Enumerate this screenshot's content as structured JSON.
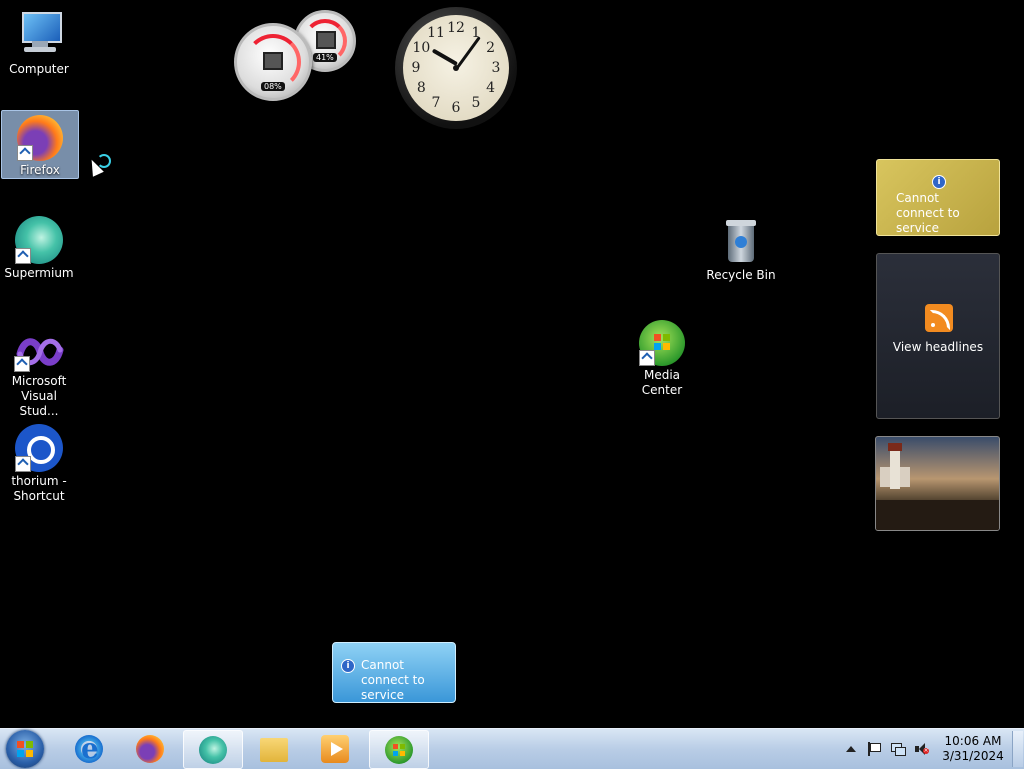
{
  "desktop": {
    "icons": [
      {
        "label": "Computer",
        "icon": "computer-icon"
      },
      {
        "label": "Firefox",
        "icon": "firefox-icon"
      },
      {
        "label": "Supermium",
        "icon": "supermium-icon"
      },
      {
        "label": "Microsoft Visual Stud...",
        "icon": "visual-studio-icon"
      },
      {
        "label": "thorium - Shortcut",
        "icon": "thorium-icon"
      },
      {
        "label": "Recycle Bin",
        "icon": "recycle-bin-icon"
      },
      {
        "label": "Media Center",
        "icon": "media-center-icon"
      }
    ]
  },
  "gadgets": {
    "cpu_meter": {
      "cpu": "08%",
      "memory": "41%"
    },
    "clock": {
      "numerals": [
        "12",
        "1",
        "2",
        "3",
        "4",
        "5",
        "6",
        "7",
        "8",
        "9",
        "10",
        "11"
      ]
    },
    "currency": {
      "message": "Cannot connect to service"
    },
    "feed": {
      "message": "View headlines"
    },
    "slideshow": {
      "image": "lighthouse-photo"
    }
  },
  "notification": {
    "message": "Cannot connect to service"
  },
  "taskbar": {
    "pinned": [
      {
        "icon": "internet-explorer-icon",
        "active": false
      },
      {
        "icon": "firefox-icon",
        "active": false
      },
      {
        "icon": "supermium-icon",
        "active": true
      },
      {
        "icon": "windows-explorer-icon",
        "active": false
      },
      {
        "icon": "windows-media-player-icon",
        "active": false
      },
      {
        "icon": "media-center-icon",
        "active": true
      }
    ],
    "tray": {
      "icons": [
        "show-hidden-icons-chevron",
        "action-center-flag-icon",
        "network-icon",
        "volume-muted-icon"
      ],
      "time": "10:06 AM",
      "date": "3/31/2024"
    }
  },
  "colors": {
    "taskbar": "#b9cde6",
    "desktop": "#000000",
    "selection": "#a0bee1"
  }
}
